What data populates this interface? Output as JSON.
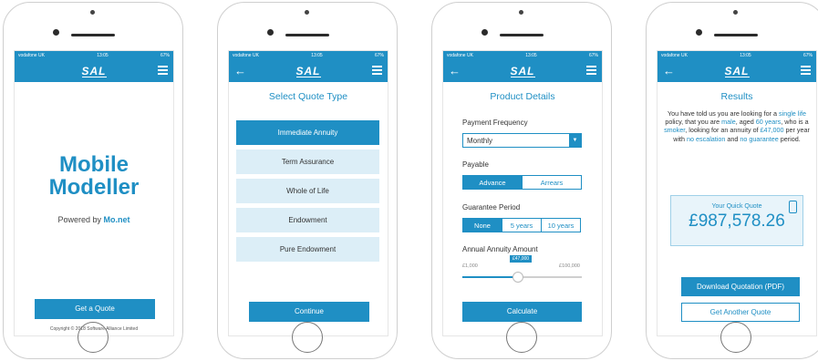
{
  "status_bar": {
    "carrier": "vodafone UK",
    "time": "13:05",
    "battery": "67%"
  },
  "app": {
    "logo": "SAL"
  },
  "screen1": {
    "title_line1": "Mobile",
    "title_line2": "Modeller",
    "powered_prefix": "Powered by ",
    "powered_brand": "Mo.net",
    "cta": "Get a Quote",
    "copyright": "Copyright © 2018 Software Alliance Limited"
  },
  "screen2": {
    "title": "Select Quote Type",
    "options": [
      "Immediate Annuity",
      "Term Assurance",
      "Whole of Life",
      "Endowment",
      "Pure Endowment"
    ],
    "selected_index": 0,
    "continue": "Continue"
  },
  "screen3": {
    "title": "Product Details",
    "payment_frequency_label": "Payment Frequency",
    "payment_frequency_value": "Monthly",
    "payable_label": "Payable",
    "payable_options": [
      "Advance",
      "Arrears"
    ],
    "payable_selected": "Advance",
    "guarantee_label": "Guarantee Period",
    "guarantee_options": [
      "None",
      "5 years",
      "10 years"
    ],
    "guarantee_selected": "None",
    "annuity_label": "Annual Annuity Amount",
    "annuity_min": "£1,000",
    "annuity_max": "£100,000",
    "annuity_value": "£47,000",
    "annuity_fraction": 0.465,
    "calculate": "Calculate"
  },
  "screen4": {
    "title": "Results",
    "t1": "You have told us you are looking for a ",
    "policy": "single life",
    "t2": " policy, that you are ",
    "gender": "male",
    "t3": ", aged ",
    "age": "60 years",
    "t4": ", who is a ",
    "smoker": "smoker",
    "t5": ", looking for an annuity of ",
    "amount": "£47,000",
    "t6": " per year with ",
    "escalation": "no escalation",
    "t7": " and ",
    "guarantee": "no guarantee",
    "t8": " period.",
    "quote_label": "Your Quick Quote",
    "quote_amount": "£987,578.26",
    "download": "Download Quotation (PDF)",
    "another": "Get Another Quote"
  }
}
